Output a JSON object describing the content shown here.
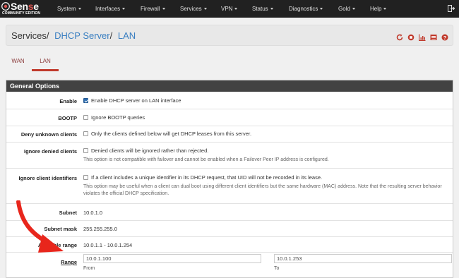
{
  "brand": {
    "name_prefix": "Sen",
    "name_red": "s",
    "name_suffix": "e",
    "edition": "COMMUNITY EDITION",
    "logo_icon": "pfsense-logo"
  },
  "nav": {
    "items": [
      {
        "label": "System"
      },
      {
        "label": "Interfaces"
      },
      {
        "label": "Firewall"
      },
      {
        "label": "Services"
      },
      {
        "label": "VPN"
      },
      {
        "label": "Status"
      },
      {
        "label": "Diagnostics"
      },
      {
        "label": "Gold"
      },
      {
        "label": "Help"
      }
    ],
    "logout_icon": "logout-icon"
  },
  "breadcrumb": {
    "root": "Services",
    "level2": "DHCP Server",
    "level3": "LAN",
    "separator": "/",
    "icons": [
      "restart-service-icon",
      "stop-service-icon",
      "status-chart-icon",
      "log-icon",
      "help-icon"
    ]
  },
  "tabs": [
    {
      "label": "WAN",
      "active": false
    },
    {
      "label": "LAN",
      "active": true
    }
  ],
  "panel": {
    "title": "General Options",
    "enable": {
      "label": "Enable",
      "checked": true,
      "text": "Enable DHCP server on LAN interface"
    },
    "bootp": {
      "label": "BOOTP",
      "checked": false,
      "text": "Ignore BOOTP queries"
    },
    "deny_unknown": {
      "label": "Deny unknown clients",
      "checked": false,
      "text": "Only the clients defined below will get DHCP leases from this server."
    },
    "ignore_denied": {
      "label": "Ignore denied clients",
      "checked": false,
      "text": "Denied clients will be ignored rather than rejected.",
      "help": "This option is not compatible with failover and cannot be enabled when a Failover Peer IP address is configured."
    },
    "ignore_uid": {
      "label": "Ignore client identifiers",
      "checked": false,
      "text": "If a client includes a unique identifier in its DHCP request, that UID will not be recorded in its lease.",
      "help": "This option may be useful when a client can dual boot using different client identifiers but the same hardware (MAC) address. Note that the resulting server behavior violates the official DHCP specification."
    },
    "subnet": {
      "label": "Subnet",
      "value": "10.0.1.0"
    },
    "subnet_mask": {
      "label": "Subnet mask",
      "value": "255.255.255.0"
    },
    "available_range": {
      "label": "Available range",
      "value": "10.0.1.1 - 10.0.1.254"
    },
    "range": {
      "label": "Range",
      "from_value": "10.0.1.100",
      "from_caption": "From",
      "to_value": "10.0.1.253",
      "to_caption": "To"
    }
  },
  "colors": {
    "navbar": "#212121",
    "accent_red": "#c0392b",
    "link_blue": "#3a7fc1",
    "panel_head": "#424242",
    "annotation_arrow": "#e8261c"
  }
}
